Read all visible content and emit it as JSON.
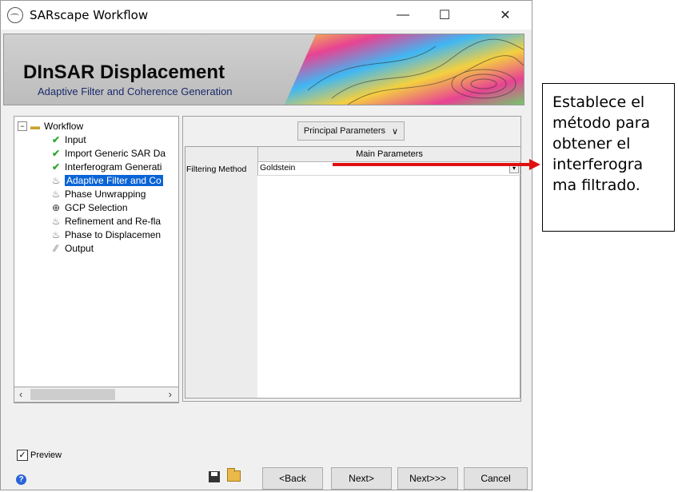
{
  "window": {
    "title": "SARscape Workflow",
    "controls": {
      "minimize": "—",
      "maximize": "☐",
      "close": "✕"
    }
  },
  "banner": {
    "title": "DInSAR Displacement",
    "subtitle": "Adaptive Filter and Coherence Generation"
  },
  "tree": {
    "root": "Workflow",
    "items": [
      {
        "label": "Input",
        "status": "done"
      },
      {
        "label": "Import Generic SAR Da",
        "status": "done"
      },
      {
        "label": "Interferogram Generati",
        "status": "done"
      },
      {
        "label": "Adaptive Filter and Co",
        "status": "current"
      },
      {
        "label": "Phase Unwrapping",
        "status": "pending"
      },
      {
        "label": "GCP Selection",
        "status": "gcp"
      },
      {
        "label": "Refinement and Re-fla",
        "status": "pending"
      },
      {
        "label": "Phase to Displacemen",
        "status": "pending"
      },
      {
        "label": "Output",
        "status": "output"
      }
    ]
  },
  "params": {
    "selector": "Principal Parameters",
    "table_header": "Main Parameters",
    "row_label": "Filtering Method",
    "row_value": "Goldstein"
  },
  "footer": {
    "preview_label": "Preview",
    "preview_checked": true,
    "buttons": {
      "back": "<Back",
      "next": "Next>",
      "next_all": "Next>>>",
      "cancel": "Cancel"
    }
  },
  "callout": {
    "text": "Establece el método para obtener el interferograma filtrado.",
    "lines": [
      "Establece el",
      "método para",
      "obtener el",
      "interferogra",
      "ma filtrado."
    ]
  },
  "colors": {
    "selection": "#0a64d6",
    "arrow": "#e01010",
    "check": "#2ea82e"
  }
}
